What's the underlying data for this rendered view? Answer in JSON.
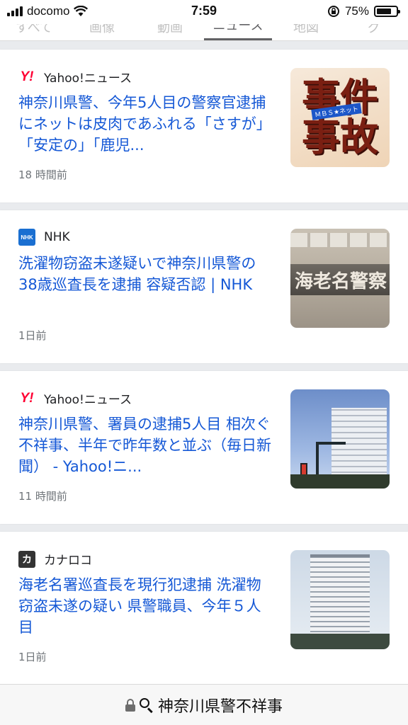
{
  "status_bar": {
    "carrier": "docomo",
    "time": "7:59",
    "battery_percent": "75%",
    "battery_level": 0.75
  },
  "tabs": [
    {
      "label": "すべて"
    },
    {
      "label": "画像"
    },
    {
      "label": "動画"
    },
    {
      "label": "ニュース",
      "active": true
    },
    {
      "label": "地図"
    },
    {
      "label": "ショッピング"
    }
  ],
  "results": [
    {
      "source": "Yahoo!ニュース",
      "source_icon": "yahoo-logo-icon",
      "title": "神奈川県警、今年5人目の警察官逮捕にネットは皮肉であふれる「さすが」「安定の」「鹿児...",
      "time": "18 時間前",
      "thumb_text_1": "事件",
      "thumb_text_2": "事故",
      "thumb_tag": "ＭＢＳ★ネット"
    },
    {
      "source": "NHK",
      "source_icon": "nhk-logo-icon",
      "title": "洗濯物窃盗未遂疑いで神奈川県警の38歳巡査長を逮捕 容疑否認 | NHK",
      "time": "1日前",
      "thumb_sign": "海老名警察"
    },
    {
      "source": "Yahoo!ニュース",
      "source_icon": "yahoo-logo-icon",
      "title": "神奈川県警、署員の逮捕5人目 相次ぐ不祥事、半年で昨年数と並ぶ（毎日新聞） - Yahoo!ニ...",
      "time": "11 時間前"
    },
    {
      "source": "カナロコ",
      "source_icon": "kanaloco-logo-icon",
      "title": "海老名署巡査長を現行犯逮捕 洗濯物窃盗未遂の疑い 県警職員、今年５人目",
      "time": "1日前"
    }
  ],
  "search_bar": {
    "query": "神奈川県警不祥事"
  }
}
